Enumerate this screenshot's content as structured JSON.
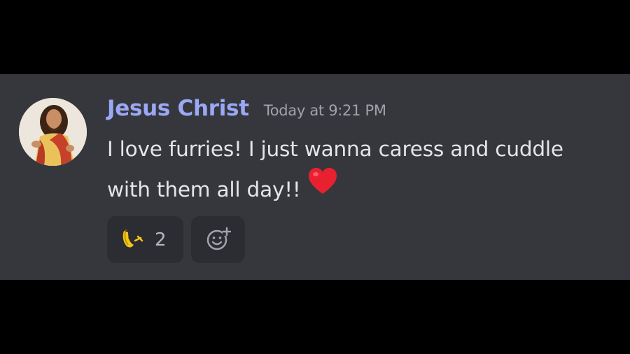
{
  "message": {
    "author": "Jesus Christ",
    "timestamp": "Today at 9:21 PM",
    "lines": [
      "I love furries! I just wanna caress and cuddle",
      "with them all day!!"
    ],
    "inline_emoji": "heart-emoji"
  },
  "reactions": [
    {
      "icon": "dancing-banana-emoji",
      "count": "2"
    }
  ],
  "add_reaction_icon": "add-reaction-icon",
  "colors": {
    "background": "#000000",
    "panel": "#36373d",
    "username": "#9aa8f5",
    "text": "#e3e5e8",
    "timestamp": "#a0a3aa",
    "reaction_bg": "#2c2d32",
    "heart": "#e8202f"
  }
}
